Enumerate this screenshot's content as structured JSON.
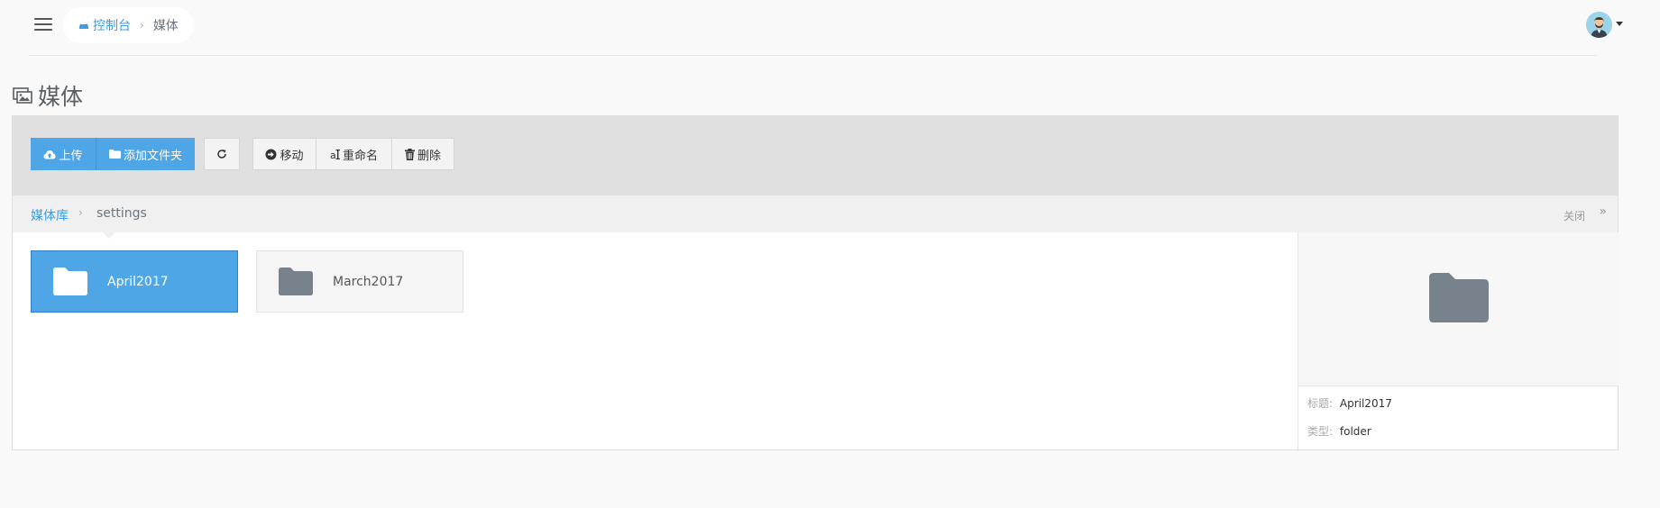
{
  "topbar": {
    "home_label": "控制台",
    "current": "媒体"
  },
  "page": {
    "title": "媒体"
  },
  "toolbar": {
    "upload": "上传",
    "add_folder": "添加文件夹",
    "move": "移动",
    "rename": "重命名",
    "delete": "删除"
  },
  "path": {
    "library": "媒体库",
    "current": "settings",
    "close": "关闭"
  },
  "folders": [
    {
      "name": "April2017",
      "selected": true
    },
    {
      "name": "March2017",
      "selected": false
    }
  ],
  "details": {
    "title_label": "标题:",
    "title_value": "April2017",
    "type_label": "类型:",
    "type_value": "folder"
  },
  "colors": {
    "accent": "#4ea6e6",
    "link": "#3c9de0",
    "folder_grey": "#78828c"
  }
}
